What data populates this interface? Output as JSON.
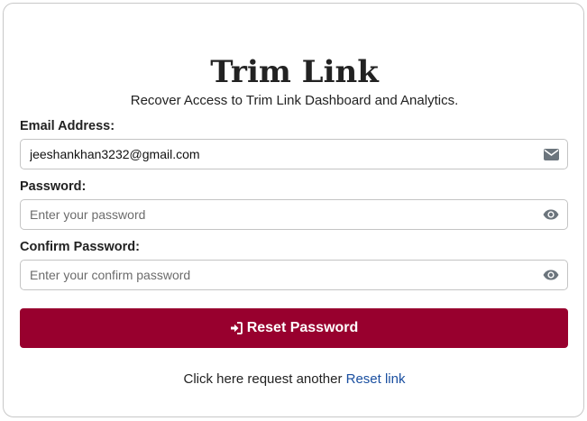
{
  "header": {
    "brand": "Trim Link",
    "subtitle": "Recover Access to Trim Link Dashboard and Analytics."
  },
  "form": {
    "email": {
      "label": "Email Address:",
      "value": "jeeshankhan3232@gmail.com",
      "icon": "envelope-icon"
    },
    "password": {
      "label": "Password:",
      "placeholder": "Enter your password",
      "value": "",
      "icon": "eye-icon"
    },
    "confirm_password": {
      "label": "Confirm Password:",
      "placeholder": "Enter your confirm password",
      "value": "",
      "icon": "eye-icon"
    },
    "submit": {
      "label": "Reset Password",
      "icon": "sign-in-icon"
    }
  },
  "footer": {
    "text": "Click here request another",
    "link_label": "Reset link"
  },
  "colors": {
    "primary_button": "#98002e",
    "link": "#1a4fa0",
    "icon": "#6c757d"
  }
}
